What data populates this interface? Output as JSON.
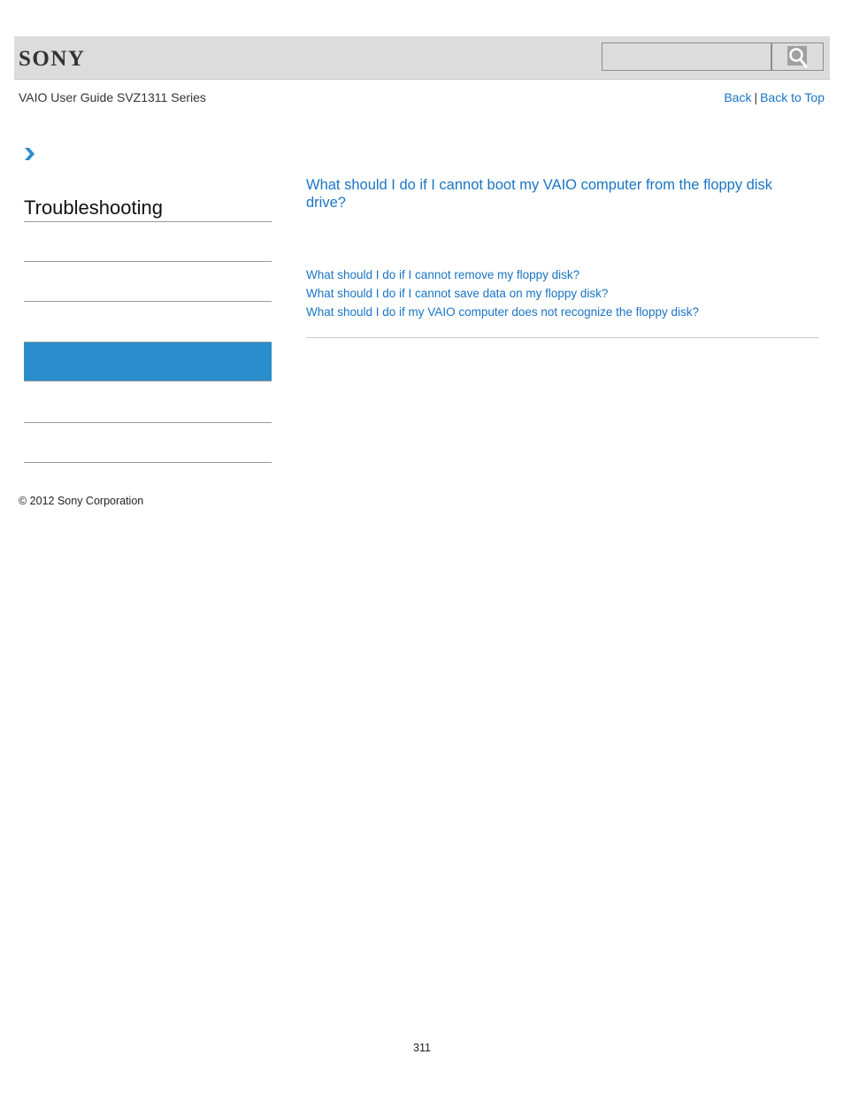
{
  "header": {
    "logo": "SONY",
    "search": {
      "value": "",
      "placeholder": ""
    },
    "search_icon": "search-icon"
  },
  "subheader": {
    "guide_title": "VAIO User Guide SVZ1311 Series",
    "back_label": "Back",
    "separator": "|",
    "back_to_top_label": "Back to Top"
  },
  "breadcrumb": {
    "icon": "chevron-right-icon"
  },
  "sidebar": {
    "title": "Troubleshooting",
    "items": [
      {
        "label": "",
        "active": false
      },
      {
        "label": "",
        "active": false
      },
      {
        "label": "",
        "active": true
      },
      {
        "label": "",
        "active": false
      },
      {
        "label": "",
        "active": false
      }
    ],
    "active_color": "#2a8ecd"
  },
  "main": {
    "title": "What should I do if I cannot boot my VAIO computer from the floppy disk drive?",
    "related_links": [
      "What should I do if I cannot remove my floppy disk?",
      "What should I do if I cannot save data on my floppy disk?",
      "What should I do if my VAIO computer does not recognize the floppy disk?"
    ],
    "link_color": "#1a74c4"
  },
  "footer": {
    "copyright": "© 2012 Sony Corporation",
    "page_number": "311"
  }
}
